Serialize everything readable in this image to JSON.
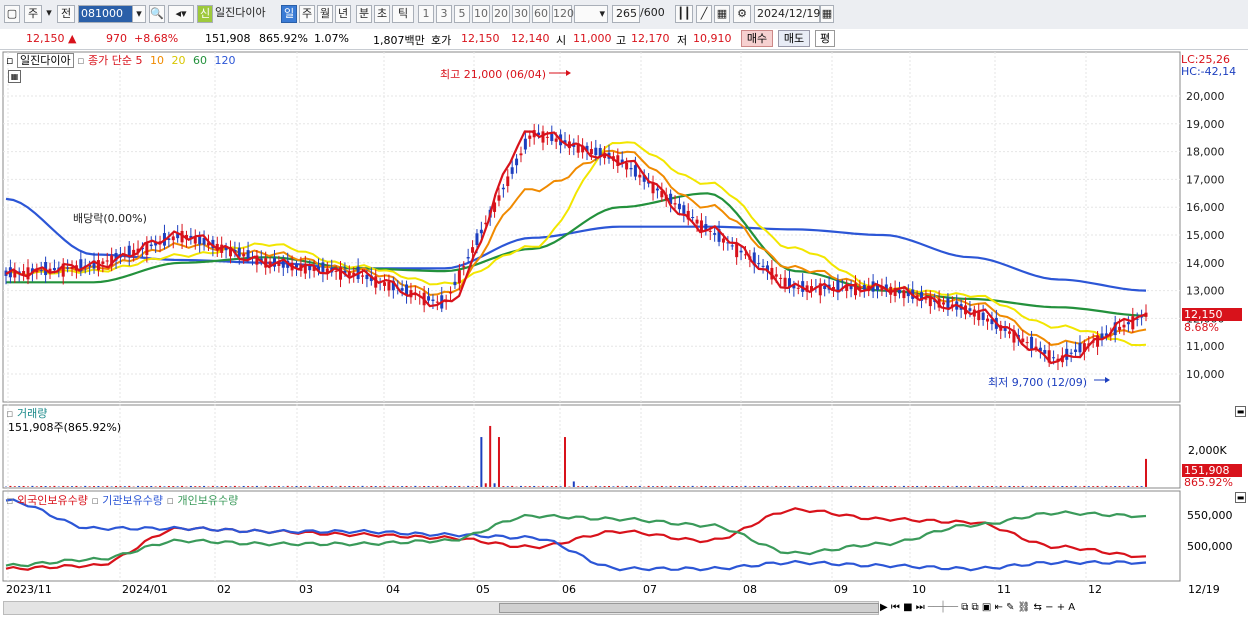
{
  "toolbar": {
    "period_type": "주",
    "prev_label": "전",
    "stock_code": "081000",
    "new_badge": "신",
    "stock_name": "일진다이아",
    "intervals": [
      "일",
      "주",
      "월",
      "년",
      "분",
      "초",
      "틱"
    ],
    "active_interval": "일",
    "numbers": [
      "1",
      "3",
      "5",
      "10",
      "20",
      "30",
      "60",
      "120"
    ],
    "count_value": "265",
    "count_total": "/600",
    "date": "2024/12/19"
  },
  "quote": {
    "price": "12,150",
    "change": "970",
    "change_pct": "+8.68%",
    "volume": "151,908",
    "volume_pct": "865.92%",
    "turnover": "1.07%",
    "amount": "1,807백만",
    "bid_label": "호가",
    "ask": "12,150",
    "bid": "12,140",
    "open_label": "시",
    "open": "11,000",
    "high_label": "고",
    "high": "12,170",
    "low_label": "저",
    "low": "10,910",
    "buy_label": "매수",
    "sell_label": "매도",
    "eval_label": "평"
  },
  "price_panel": {
    "stock_name": "일진다이아",
    "ma_title": "종가 단순",
    "ma_periods": [
      "5",
      "10",
      "20",
      "60",
      "120"
    ],
    "ma_colors": [
      "#d8121b",
      "#f08a00",
      "#f2e600",
      "#23913c",
      "#2c56d6"
    ],
    "lc": "LC:25,26",
    "hc": "HC:-42,14",
    "y_ticks": [
      "20,000",
      "19,000",
      "18,000",
      "17,000",
      "16,000",
      "15,000",
      "14,000",
      "13,000",
      "12,000",
      "11,000",
      "10,000"
    ],
    "current_tag": "12,150",
    "current_pct_tag": "8.68%",
    "high_annotation": "최고 21,000 (06/04)",
    "low_annotation": "최저 9,700 (12/09)",
    "dividend_annotation": "배당락(0.00%)"
  },
  "volume_panel": {
    "title": "거래량",
    "subtitle": "151,908주(865.92%)",
    "y_tick": "2,000K",
    "current_tag": "151,908",
    "current_pct_tag": "865.92%"
  },
  "holdings_panel": {
    "series_labels": [
      "외국인보유수량",
      "기관보유수량",
      "개인보유수량"
    ],
    "series_colors": [
      "#d8121b",
      "#2c56d6",
      "#3a9a5a"
    ],
    "y_ticks": [
      "550,000",
      "500,000"
    ]
  },
  "x_axis": {
    "labels": [
      "2023/11",
      "2024/01",
      "02",
      "03",
      "04",
      "05",
      "06",
      "07",
      "08",
      "09",
      "10",
      "11",
      "12",
      "12/19"
    ]
  },
  "chart_data": [
    {
      "type": "line",
      "title": "일진다이아",
      "series": [
        {
          "name": "종가 단순 5"
        },
        {
          "name": "종가 단순 60"
        },
        {
          "name": "종가 단순 120"
        }
      ],
      "x": [
        "2023/11",
        "2024/01",
        "02",
        "03",
        "04",
        "05",
        "06",
        "07",
        "08",
        "09",
        "10",
        "11",
        "12",
        "12/19"
      ],
      "values_ma60": [
        13300,
        13300,
        14000,
        14200,
        13800,
        13700,
        14500,
        16000,
        16500,
        13700,
        13000,
        12700,
        12400,
        12100
      ],
      "values_ma120": [
        16300,
        14300,
        14100,
        14000,
        13800,
        13800,
        14900,
        15300,
        15300,
        15200,
        15000,
        14200,
        13400,
        13000
      ],
      "values_close": [
        13600,
        13900,
        15000,
        14000,
        13600,
        12500,
        18700,
        17700,
        15200,
        13100,
        13100,
        12300,
        10500,
        12150
      ],
      "ylim": [
        9500,
        21500
      ]
    },
    {
      "type": "bar",
      "title": "거래량",
      "series": [
        {
          "name": "거래량",
          "values": [
            40,
            60,
            70,
            40,
            45,
            50,
            2700,
            3300,
            200,
            2700,
            200,
            150,
            100,
            80,
            151.9
          ]
        }
      ]
    },
    {
      "type": "line",
      "series": [
        {
          "name": "외국인보유수량",
          "values": [
            465000,
            470000,
            530000,
            525000,
            520000,
            515000,
            500000,
            525000,
            510000,
            560000,
            545000,
            540000,
            500000,
            485000
          ]
        },
        {
          "name": "기관보유수량",
          "values": [
            575000,
            530000,
            530000,
            525000,
            525000,
            520000,
            515000,
            465000,
            465000,
            475000,
            470000,
            465000,
            475000,
            475000
          ]
        },
        {
          "name": "개인보유수량",
          "values": [
            470000,
            480000,
            510000,
            505000,
            505000,
            510000,
            550000,
            545000,
            535000,
            490000,
            505000,
            535000,
            555000,
            550000
          ]
        }
      ]
    }
  ]
}
